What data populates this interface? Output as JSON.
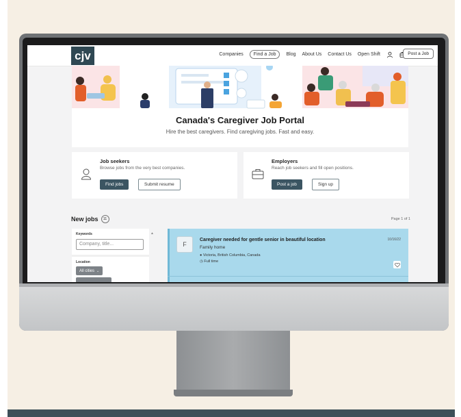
{
  "nav": {
    "logo": "cjv",
    "links": [
      "Companies",
      "Find a Job",
      "Blog",
      "About Us",
      "Contact Us",
      "Open Shift"
    ],
    "active_link": "Find a Job",
    "post_job": "Post a Job",
    "icons": [
      "user-icon",
      "briefcase-icon"
    ]
  },
  "hero": {
    "title": "Canada's Caregiver Job Portal",
    "subtitle": "Hire the best caregivers. Find caregiving jobs. Fast and easy."
  },
  "job_seekers": {
    "title": "Job seekers",
    "description": "Browse jobs from the very best companies.",
    "primary": "Find jobs",
    "secondary": "Submit resume"
  },
  "employers": {
    "title": "Employers",
    "description": "Reach job seekers and fill open positions.",
    "primary": "Post a job",
    "secondary": "Sign up"
  },
  "new_jobs": {
    "title": "New jobs",
    "count": "11",
    "page_info": "Page 1 of 1"
  },
  "filters": {
    "keywords_label": "Keywords",
    "keywords_placeholder": "Company, title...",
    "location_label": "Location",
    "location_value": "All cities"
  },
  "job": {
    "avatar_letter": "F",
    "title": "Caregiver needed for gentle senior in beautiful location",
    "company": "Family home",
    "location": "Victoria, British Columbia, Canada",
    "type": "Full time",
    "date": "10/16/22"
  },
  "colors": {
    "nav_logo_bg": "#2f4853",
    "primary_button": "#3b5562",
    "job_highlight": "#a9d9ec",
    "page_background": "#f6efe4"
  }
}
